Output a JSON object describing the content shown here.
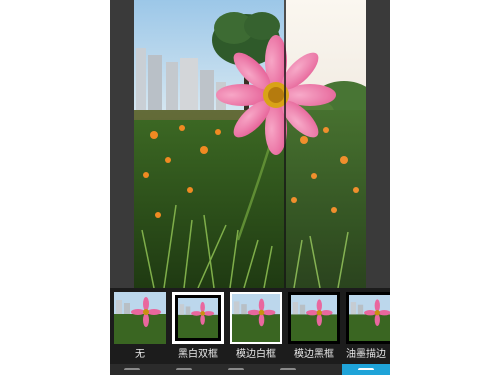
{
  "preview": {
    "image_name": "cosmos-flower-photo",
    "compare_split": "original-left / filtered-right"
  },
  "frames": {
    "items": [
      {
        "label": "无",
        "style": "none"
      },
      {
        "label": "黑白双框",
        "style": "double"
      },
      {
        "label": "模边白框",
        "style": "white"
      },
      {
        "label": "模边黑框",
        "style": "black"
      },
      {
        "label": "油墨描边",
        "style": "ink"
      }
    ],
    "selected_index": 1
  },
  "bottom_bar": {
    "icons": [
      "crop-icon",
      "adjust-icon",
      "edit-icon",
      "effects-icon",
      "frame-icon"
    ],
    "active_icon": "frame-icon",
    "active_color": "#1fa3d8"
  }
}
